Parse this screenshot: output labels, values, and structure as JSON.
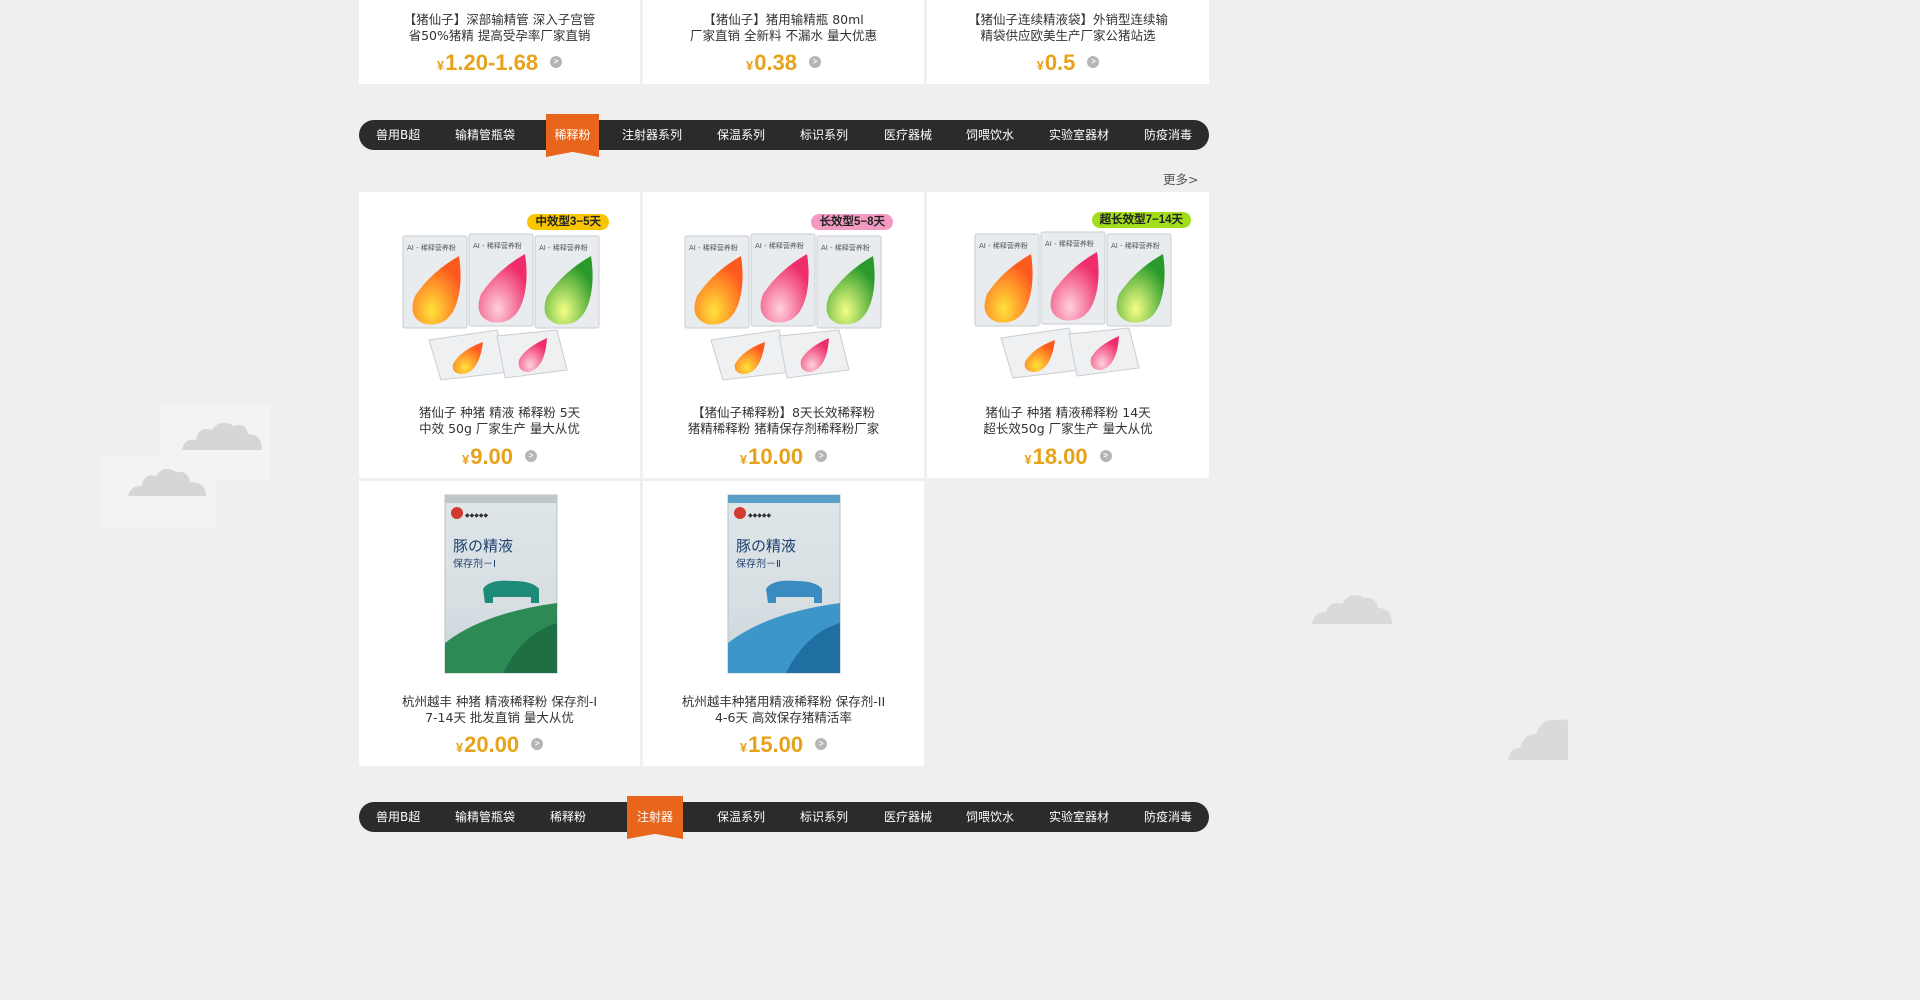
{
  "top_products": [
    {
      "title_line1": "【猪仙子】深部输精管 深入子宫管",
      "title_line2": "省50%猪精 提高受孕率厂家直销",
      "price_symbol": "¥",
      "price": "1.20-1.68"
    },
    {
      "title_line1": "【猪仙子】猪用输精瓶 80ml",
      "title_line2": "厂家直销 全新料 不漏水 量大优惠",
      "price_symbol": "¥",
      "price": "0.38"
    },
    {
      "title_line1": "【猪仙子连续精液袋】外销型连续输",
      "title_line2": "精袋供应欧美生产厂家公猪站选",
      "price_symbol": "¥",
      "price": "0.5"
    }
  ],
  "nav": {
    "items": [
      "兽用B超",
      "输精管瓶袋",
      "稀释粉",
      "注射器系列",
      "保温系列",
      "标识系列",
      "医疗器械",
      "饲喂饮水",
      "实验室器材",
      "防疫消毒"
    ],
    "active_label": "稀释粉"
  },
  "nav_bottom": {
    "items": [
      "兽用B超",
      "输精管瓶袋",
      "稀释粉",
      "注射器",
      "保温系列",
      "标识系列",
      "医疗器械",
      "饲喂饮水",
      "实验室器材",
      "防疫消毒"
    ],
    "active_label": "注射器"
  },
  "more_link": "更多> >",
  "products": [
    {
      "tag": "中效型3−5天",
      "tag_color": "#f7c600",
      "title_line1": "猪仙子 种猪 精液 稀释粉 5天",
      "title_line2": "中效 50g 厂家生产 量大从优",
      "price_symbol": "¥",
      "price": "9.00",
      "image": "ai-diluent-powder-packets"
    },
    {
      "tag": "长效型5−8天",
      "tag_color": "#f39ac3",
      "title_line1": "【猪仙子稀释粉】8天长效稀释粉",
      "title_line2": "猪精稀释粉 猪精保存剂稀释粉厂家",
      "price_symbol": "¥",
      "price": "10.00",
      "image": "ai-diluent-powder-packets"
    },
    {
      "tag": "超长效型7−14天",
      "tag_color": "#a3de1c",
      "title_line1": "猪仙子 种猪 精液稀释粉 14天",
      "title_line2": "超长效50g 厂家生产 量大从优",
      "price_symbol": "¥",
      "price": "18.00",
      "image": "ai-diluent-powder-packets"
    },
    {
      "title_line1": "杭州越丰 种猪 精液稀释粉 保存剂-I",
      "title_line2": "7-14天 批发直销 量大从优",
      "price_symbol": "¥",
      "price": "20.00",
      "image": "semen-preservative-bag-green"
    },
    {
      "title_line1": "杭州越丰种猪用精液稀释粉 保存剂-II",
      "title_line2": "4-6天 高效保存猪精活率",
      "price_symbol": "¥",
      "price": "15.00",
      "image": "semen-preservative-bag-blue"
    }
  ],
  "bag_labels": [
    {
      "name": "豚の精液",
      "sub": "保存剂－Ⅰ"
    },
    {
      "name": "豚の精液",
      "sub": "保存剂－Ⅱ"
    }
  ],
  "packet_label": "AI - 稀释营养粉",
  "go_glyph": ">"
}
